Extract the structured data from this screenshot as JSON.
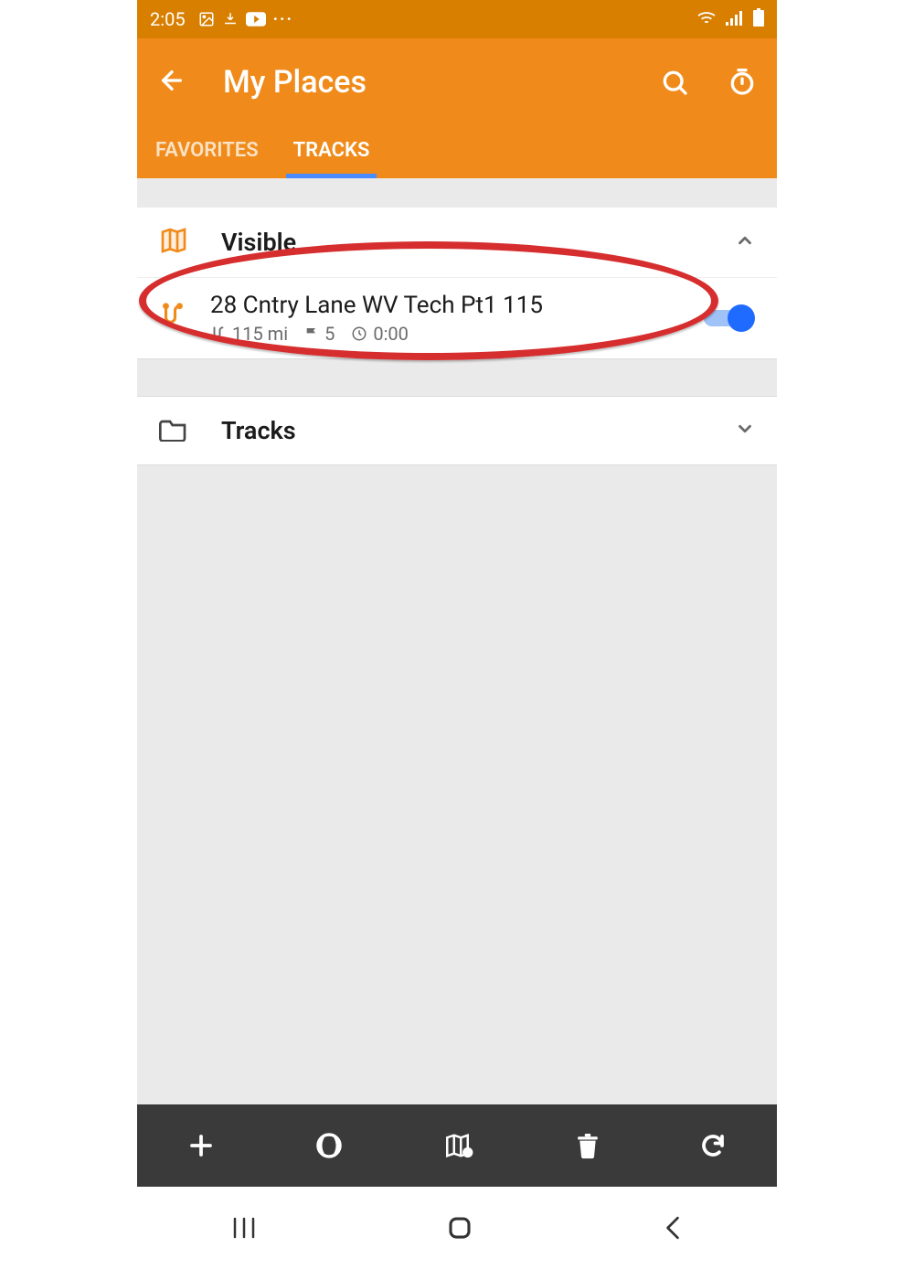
{
  "status": {
    "time": "2:05"
  },
  "header": {
    "title": "My Places"
  },
  "tabs": {
    "favorites": "FAVORITES",
    "tracks": "TRACKS",
    "active": "tracks"
  },
  "sections": {
    "visible": {
      "label": "Visible",
      "expanded": true
    },
    "tracks_folder": {
      "label": "Tracks",
      "expanded": false
    }
  },
  "track": {
    "title": "28 Cntry Lane WV Tech Pt1 115",
    "distance": "115 mi",
    "waypoints": "5",
    "duration": "0:00",
    "visible": true
  }
}
